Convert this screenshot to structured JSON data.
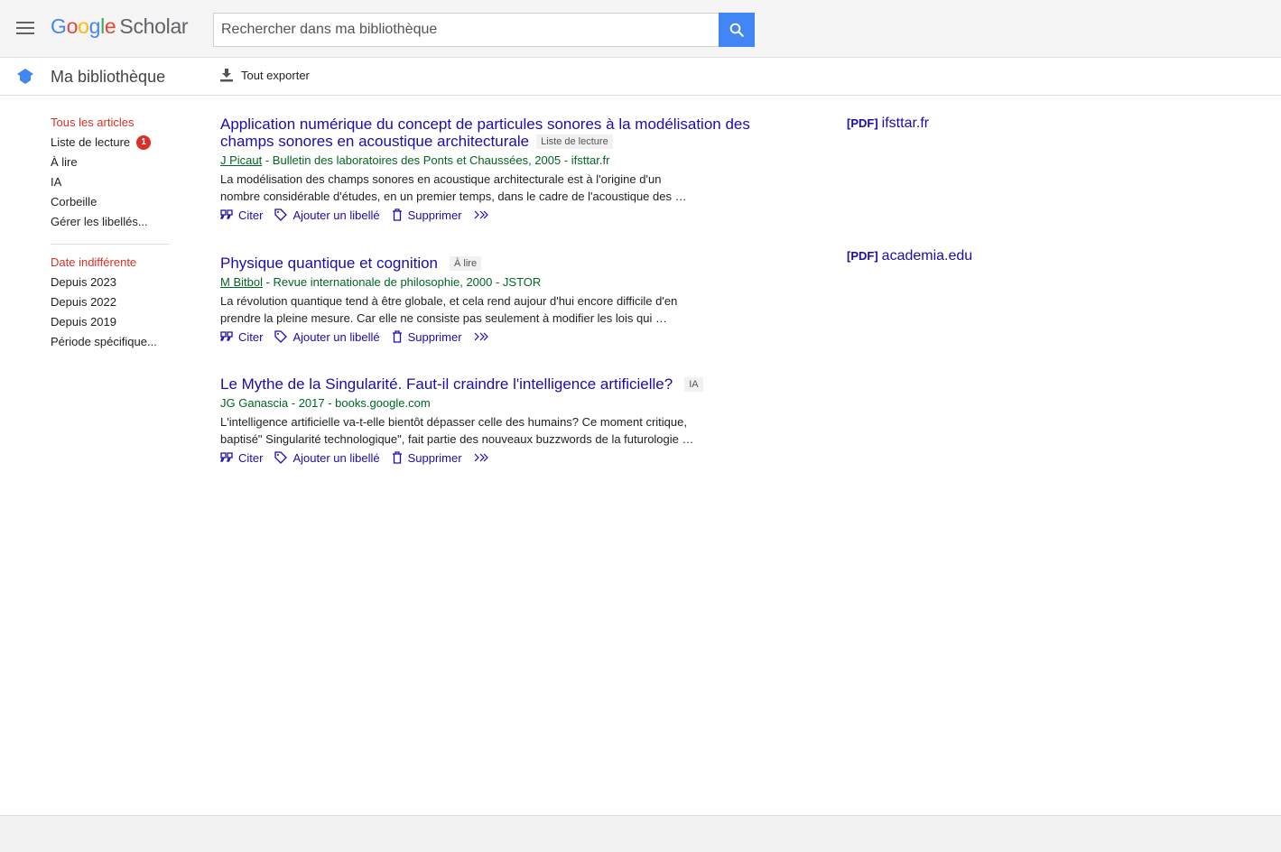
{
  "header": {
    "logo_google": [
      "G",
      "o",
      "o",
      "g",
      "l",
      "e"
    ],
    "logo_scholar": "Scholar",
    "search_placeholder": "Rechercher dans ma bibliothèque"
  },
  "subbar": {
    "title": "Ma bibliothèque",
    "export_label": "Tout exporter"
  },
  "sidebar": {
    "labels": [
      {
        "label": "Tous les articles",
        "active": true
      },
      {
        "label": "Liste de lecture",
        "badge": "1"
      },
      {
        "label": "À lire"
      },
      {
        "label": "IA"
      },
      {
        "label": "Corbeille"
      },
      {
        "label": "Gérer les libellés..."
      }
    ],
    "dates": [
      {
        "label": "Date indifférente",
        "active": true
      },
      {
        "label": "Depuis 2023"
      },
      {
        "label": "Depuis 2022"
      },
      {
        "label": "Depuis 2019"
      },
      {
        "label": "Période spécifique..."
      }
    ]
  },
  "actions": {
    "cite": "Citer",
    "add_label": "Ajouter un libellé",
    "delete": "Supprimer"
  },
  "results": [
    {
      "title": "Application numérique du concept de particules sonores à la modélisation des champs sonores en acoustique architecturale",
      "label": "Liste de lecture",
      "author": "J Picaut",
      "meta_rest": " - Bulletin des laboratoires des Ponts et Chaussées, 2005 - ifsttar.fr",
      "snippet": "La modélisation des champs sonores en acoustique architecturale est à l'origine d'un nombre considérable d'études, en un premier temps, dans le cadre de l'acoustique des …",
      "pdf_tag": "[PDF]",
      "pdf_source": "ifsttar.fr"
    },
    {
      "title": "Physique quantique et cognition",
      "label": "À lire",
      "author": "M Bitbol",
      "meta_rest": " - Revue internationale de philosophie, 2000 - JSTOR",
      "snippet": "La révolution quantique tend à être globale, et cela rend aujour d'hui encore difficile d'en prendre la pleine mesure. Car elle ne consiste pas seulement à modifier les lois qui …",
      "pdf_tag": "[PDF]",
      "pdf_source": "academia.edu"
    },
    {
      "title": "Le Mythe de la Singularité. Faut-il craindre l'intelligence artificielle?",
      "label": "IA",
      "author": "",
      "meta_rest": "JG Ganascia - 2017 - books.google.com",
      "snippet": "L'intelligence artificielle va-t-elle bientôt dépasser celle des humains? Ce moment critique, baptisé\" Singularité technologique\", fait partie des nouveaux buzzwords de la futurologie …",
      "pdf_tag": "",
      "pdf_source": ""
    }
  ]
}
